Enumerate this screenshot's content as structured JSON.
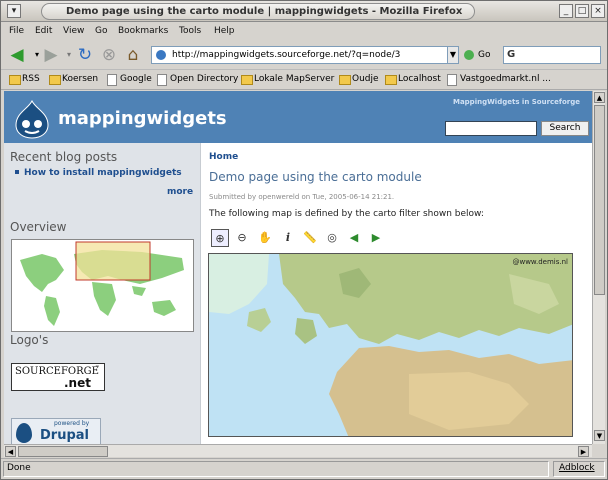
{
  "window": {
    "title": "Demo page using the carto module | mappingwidgets - Mozilla Firefox",
    "minimize": "_",
    "maximize": "□",
    "close": "×"
  },
  "menu": [
    "File",
    "Edit",
    "View",
    "Go",
    "Bookmarks",
    "Tools",
    "Help"
  ],
  "nav": {
    "url": "http://mappingwidgets.sourceforge.net/?q=node/3",
    "go_label": "Go",
    "search_engine_label": "G"
  },
  "bookmarks": [
    {
      "label": "RSS",
      "kind": "folder"
    },
    {
      "label": "Koersen",
      "kind": "folder"
    },
    {
      "label": "Google",
      "kind": "page"
    },
    {
      "label": "Open Directory",
      "kind": "page"
    },
    {
      "label": "Lokale MapServer",
      "kind": "folder"
    },
    {
      "label": "Oudje",
      "kind": "folder"
    },
    {
      "label": "Localhost",
      "kind": "folder"
    },
    {
      "label": "Vastgoedmarkt.nl ...",
      "kind": "page"
    }
  ],
  "page": {
    "site_name": "mappingwidgets",
    "header_link": "MappingWidgets in Sourceforge",
    "search_button": "Search",
    "sidebar": {
      "recent_title": "Recent blog posts",
      "recent_link": "How to install mappingwidgets",
      "more": "more",
      "overview_title": "Overview",
      "logos_title": "Logo's",
      "sourceforge_text": "SOURCEFORGE",
      "sourceforge_net": ".net",
      "sourceforge_tm": "™",
      "drupal_powered": "powered by",
      "drupal_name": "Drupal"
    },
    "breadcrumb": "Home",
    "title": "Demo page using the carto module",
    "submitted": "Submitted by openwereld on Tue, 2005-06-14 21:21.",
    "intro": "The following map is defined by the carto filter shown below:",
    "map_copyright": "@www.demis.nl"
  },
  "status": {
    "text": "Done",
    "adblock": "Adblock"
  },
  "colors": {
    "header_blue": "#4f82b5",
    "sidebar_bg": "#dfe3e8",
    "link_blue": "#1f4f8f"
  }
}
